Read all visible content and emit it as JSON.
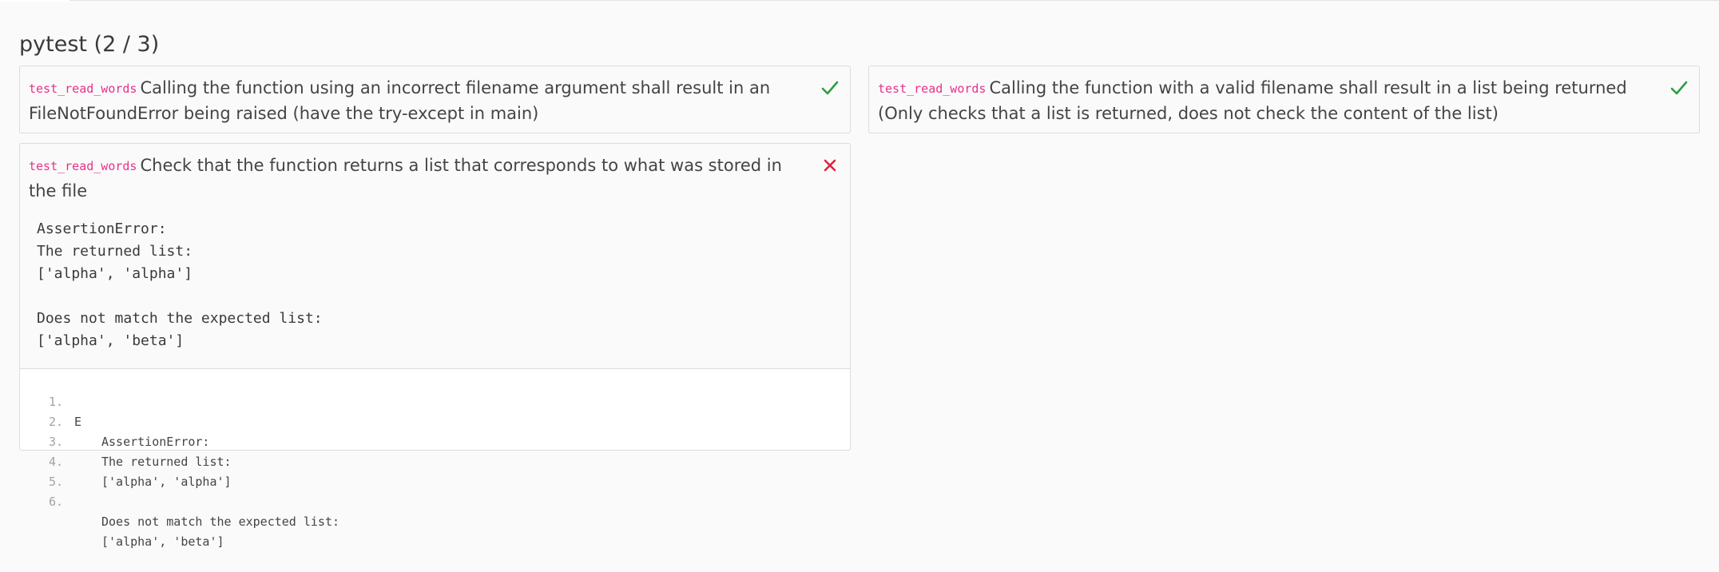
{
  "section": {
    "title": "pytest (2 / 3)"
  },
  "tests": [
    {
      "name": "test_read_words",
      "description": "Calling the function using an incorrect filename argument shall result in an FileNotFoundError being raised (have the try-except in main)",
      "status": "pass",
      "status_icon": "check-icon"
    },
    {
      "name": "test_read_words",
      "description": "Calling the function with a valid filename shall result in a list being returned (Only checks that a list is returned, does not check the content of the list)",
      "status": "pass",
      "status_icon": "check-icon"
    },
    {
      "name": "test_read_words",
      "description": "Check that the function returns a list that corresponds to what was stored in the file",
      "status": "fail",
      "status_icon": "cross-icon",
      "message": "AssertionError:\nThe returned list:\n['alpha', 'alpha']\n\nDoes not match the expected list:\n['alpha', 'beta']",
      "traceback": [
        {
          "num": "1.",
          "flag": "E",
          "text": "AssertionError:"
        },
        {
          "num": "2.",
          "flag": "",
          "text": "The returned list:"
        },
        {
          "num": "3.",
          "flag": "",
          "text": "['alpha', 'alpha']"
        },
        {
          "num": "4.",
          "flag": "",
          "text": ""
        },
        {
          "num": "5.",
          "flag": "",
          "text": "Does not match the expected list:"
        },
        {
          "num": "6.",
          "flag": "",
          "text": "['alpha', 'beta']"
        }
      ]
    }
  ],
  "colors": {
    "pass": "#2e9e44",
    "fail": "#e0243f",
    "test_name": "#e8318a"
  }
}
